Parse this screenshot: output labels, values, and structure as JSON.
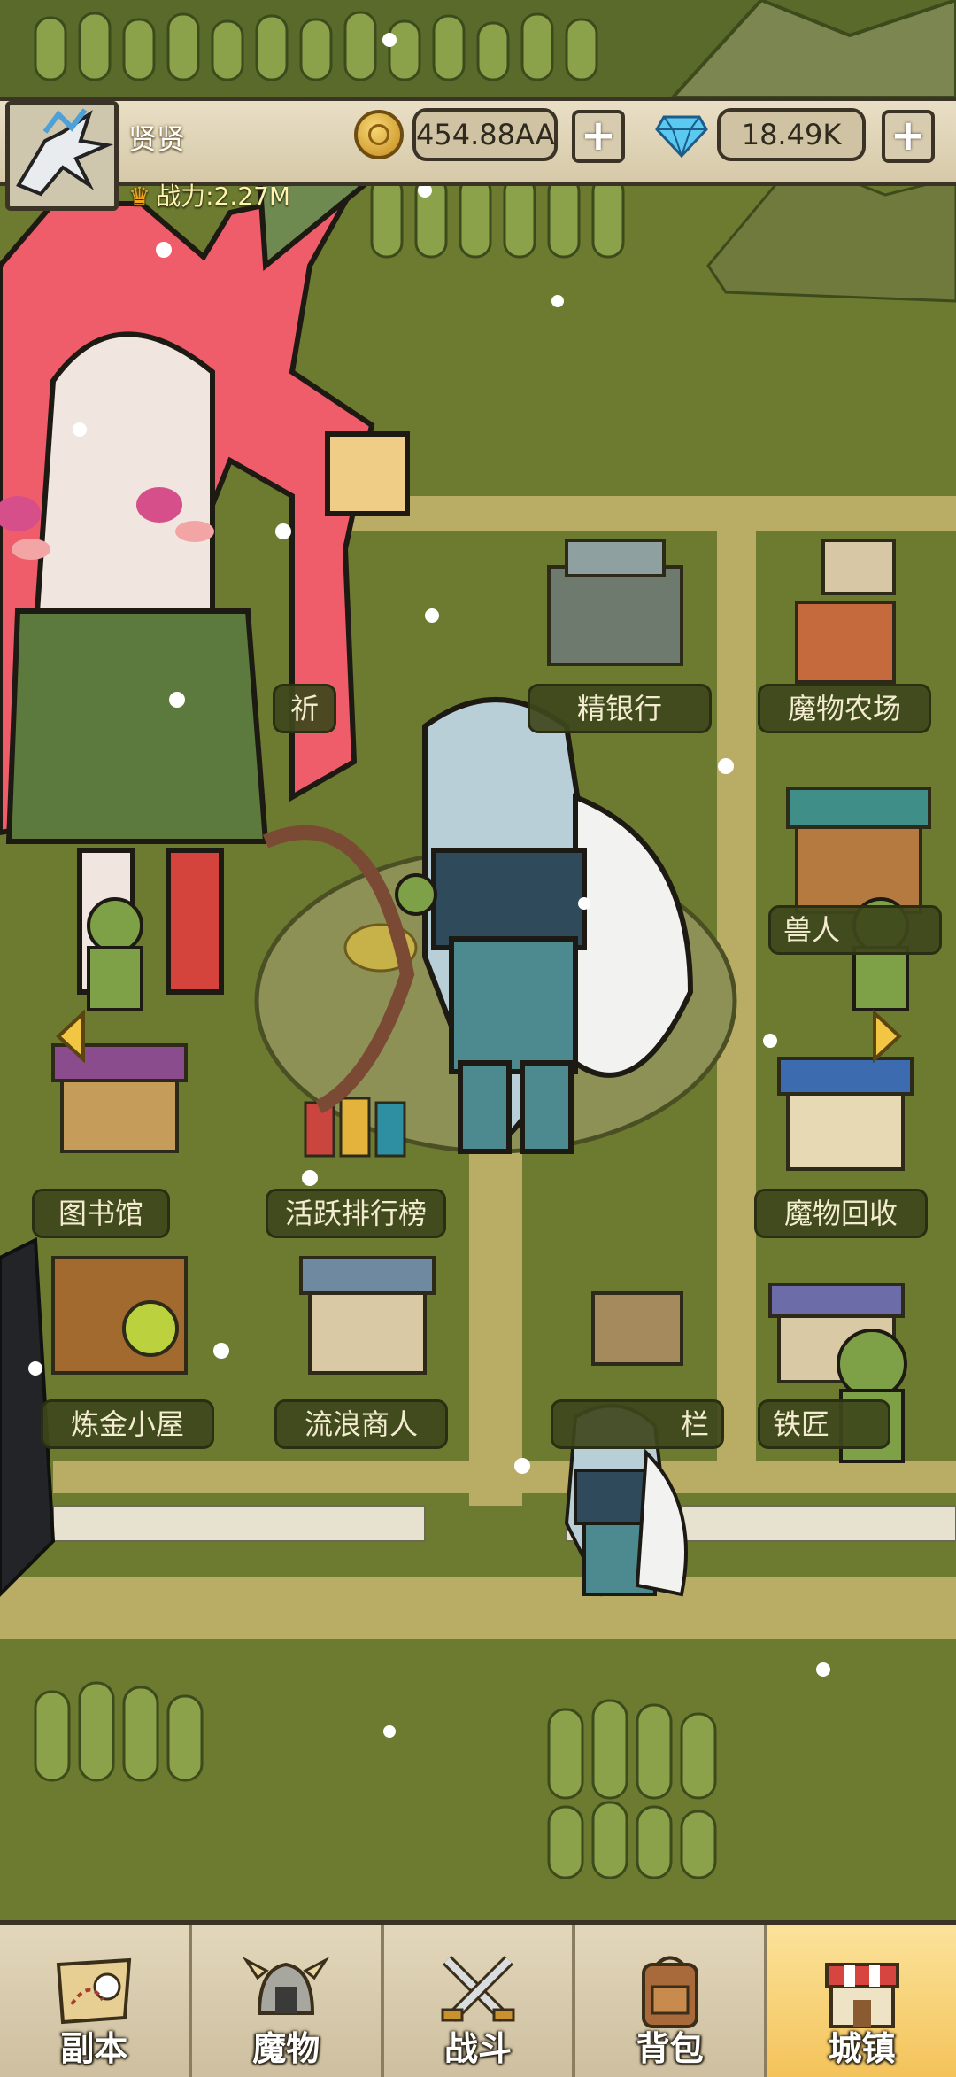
{
  "header": {
    "player_name": "贤贤",
    "power_label": "战力:2.27M",
    "gold_value": "454.88AA",
    "gem_value": "18.49K",
    "add_label": "+"
  },
  "buildings": [
    {
      "id": "bless",
      "label": "祈"
    },
    {
      "id": "bank",
      "label": "精银行"
    },
    {
      "id": "monster-farm",
      "label": "魔物农场"
    },
    {
      "id": "beast-house",
      "label": "兽人"
    },
    {
      "id": "library",
      "label": "图书馆"
    },
    {
      "id": "ranking",
      "label": "活跃排行榜"
    },
    {
      "id": "monster-recycle",
      "label": "魔物回收"
    },
    {
      "id": "alchemy",
      "label": "炼金小屋"
    },
    {
      "id": "merchant",
      "label": "流浪商人"
    },
    {
      "id": "bulletin",
      "label": "栏"
    },
    {
      "id": "blacksmith",
      "label": "铁匠"
    }
  ],
  "nav": [
    {
      "id": "dungeon",
      "label": "副本",
      "icon": "map-icon"
    },
    {
      "id": "monster",
      "label": "魔物",
      "icon": "helmet-icon"
    },
    {
      "id": "battle",
      "label": "战斗",
      "icon": "crossed-swords-icon"
    },
    {
      "id": "bag",
      "label": "背包",
      "icon": "backpack-icon"
    },
    {
      "id": "town",
      "label": "城镇",
      "icon": "shop-icon",
      "active": true
    }
  ],
  "colors": {
    "grass": "#7a8a35",
    "path": "#b8ad66",
    "nav_active": "#f4c35a",
    "label_bg": "#3e461c"
  }
}
